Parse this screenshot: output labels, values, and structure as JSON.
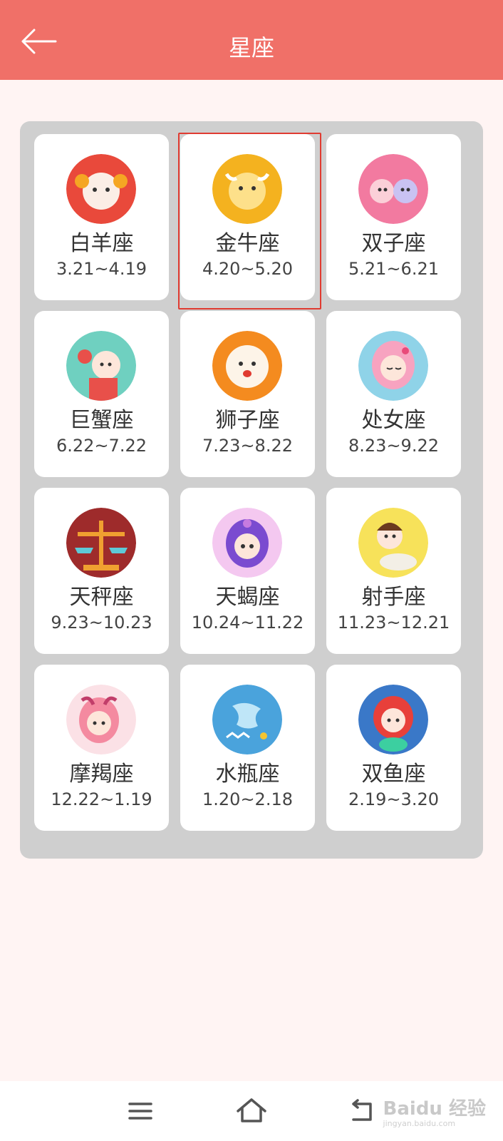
{
  "header": {
    "title": "星座"
  },
  "signs": [
    {
      "name": "白羊座",
      "date": "3.21~4.19",
      "color": "#e9493b",
      "selected": false
    },
    {
      "name": "金牛座",
      "date": "4.20~5.20",
      "color": "#f4b21f",
      "selected": true
    },
    {
      "name": "双子座",
      "date": "5.21~6.21",
      "color": "#f27aa0",
      "selected": false
    },
    {
      "name": "巨蟹座",
      "date": "6.22~7.22",
      "color": "#e8504a",
      "selected": false
    },
    {
      "name": "狮子座",
      "date": "7.23~8.22",
      "color": "#f48b1f",
      "selected": false
    },
    {
      "name": "处女座",
      "date": "8.23~9.22",
      "color": "#8fd3e8",
      "selected": false
    },
    {
      "name": "天秤座",
      "date": "9.23~10.23",
      "color": "#9e2b2b",
      "selected": false
    },
    {
      "name": "天蝎座",
      "date": "10.24~11.22",
      "color": "#c77be0",
      "selected": false
    },
    {
      "name": "射手座",
      "date": "11.23~12.21",
      "color": "#f7e25a",
      "selected": false
    },
    {
      "name": "摩羯座",
      "date": "12.22~1.19",
      "color": "#f48aa0",
      "selected": false
    },
    {
      "name": "水瓶座",
      "date": "1.20~2.18",
      "color": "#4aa3dc",
      "selected": false
    },
    {
      "name": "双鱼座",
      "date": "2.19~3.20",
      "color": "#3a78c8",
      "selected": false
    }
  ],
  "watermark": {
    "main": "Baidu 经验",
    "sub": "jingyan.baidu.com"
  }
}
